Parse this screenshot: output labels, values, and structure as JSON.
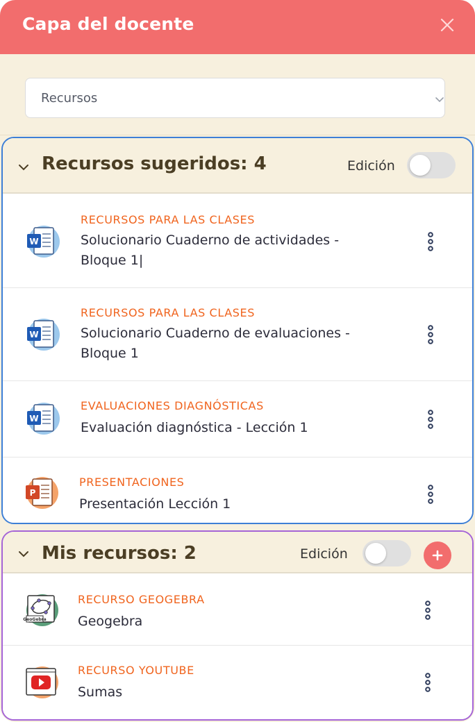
{
  "panel": {
    "title": "Capa del docente",
    "close_icon": "close-icon"
  },
  "filter": {
    "selected": "Recursos",
    "chevron_icon": "chevron-down-icon"
  },
  "suggested": {
    "title": "Recursos sugeridos: 4",
    "edit_label": "Edición",
    "edit_enabled": false,
    "items": [
      {
        "category": "RECURSOS PARA LAS CLASES",
        "name_line1": "Solucionario Cuaderno de actividades -",
        "name_line2": "Bloque 1|",
        "icon": "word-document-icon"
      },
      {
        "category": "RECURSOS PARA LAS CLASES",
        "name_line1": "Solucionario Cuaderno de evaluaciones -",
        "name_line2": "Bloque 1",
        "icon": "word-document-icon"
      },
      {
        "category": "EVALUACIONES DIAGNÓSTICAS",
        "name_line1": "Evaluación diagnóstica - Lección 1",
        "icon": "word-document-icon"
      },
      {
        "category": "PRESENTACIONES",
        "name_line1": "Presentación Lección 1",
        "icon": "powerpoint-icon"
      }
    ]
  },
  "mine": {
    "title": "Mis recursos: 2",
    "edit_label": "Edición",
    "edit_enabled": false,
    "add_icon": "plus-icon",
    "items": [
      {
        "category": "RECURSO GEOGEBRA",
        "name_line1": "Geogebra",
        "icon": "geogebra-icon",
        "icon_caption": "GeoGebra"
      },
      {
        "category": "RECURSO YOUTUBE",
        "name_line1": "Sumas",
        "icon": "youtube-icon"
      }
    ]
  },
  "colors": {
    "header": "#f26d6d",
    "category_text": "#f0641e",
    "suggested_border": "#3d7fd6",
    "mine_border": "#a564d6",
    "section_header_bg": "#f7f0de"
  }
}
